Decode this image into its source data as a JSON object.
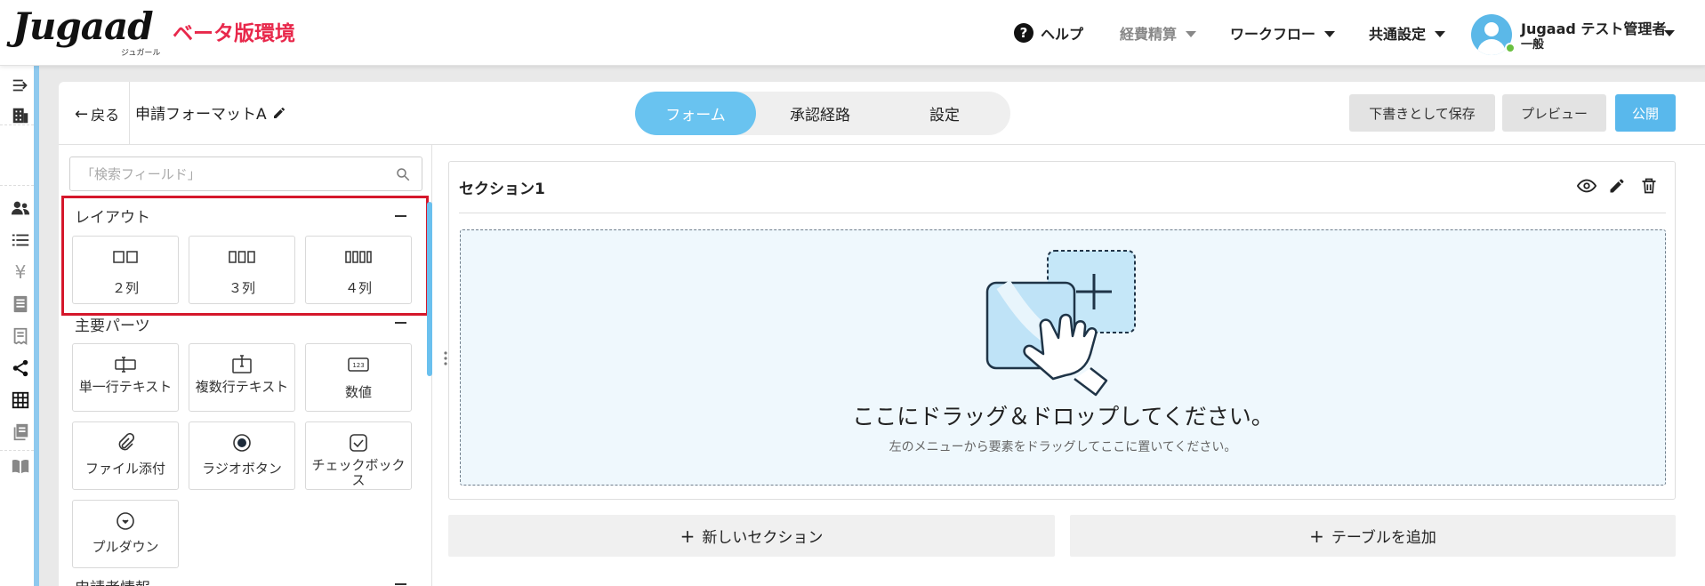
{
  "header": {
    "logo_text": "Jugaad",
    "logo_subtext": "ジュガール",
    "env_label": "ベータ版環境",
    "help_label": "ヘルプ",
    "nav": [
      {
        "label": "経費精算",
        "muted": true
      },
      {
        "label": "ワークフロー",
        "muted": false
      },
      {
        "label": "共通設定",
        "muted": false
      }
    ],
    "user": {
      "name": "Jugaad テスト管理者",
      "role": "一般"
    }
  },
  "sidebar": {
    "icons": [
      "collapse-icon",
      "building-icon",
      "users-icon",
      "list-icon",
      "yen-icon",
      "document-icon",
      "receipt-icon",
      "share-icon",
      "grid-icon",
      "files-icon",
      "book-icon"
    ]
  },
  "editor": {
    "back_label": "戻る",
    "form_title": "申請フォーマットA",
    "tabs": [
      {
        "label": "フォーム",
        "active": true
      },
      {
        "label": "承認経路",
        "active": false
      },
      {
        "label": "設定",
        "active": false
      }
    ],
    "actions": {
      "save_draft": "下書きとして保存",
      "preview": "プレビュー",
      "publish": "公開"
    }
  },
  "palette": {
    "search_placeholder": "「検索フィールド」",
    "groups": [
      {
        "title": "レイアウト",
        "items": [
          {
            "label": "２列",
            "icon": "two-column-icon"
          },
          {
            "label": "３列",
            "icon": "three-column-icon"
          },
          {
            "label": "４列",
            "icon": "four-column-icon"
          }
        ]
      },
      {
        "title": "主要パーツ",
        "items": [
          {
            "label": "単一行テキスト",
            "icon": "single-line-text-icon"
          },
          {
            "label": "複数行テキスト",
            "icon": "multi-line-text-icon"
          },
          {
            "label": "数値",
            "icon": "number-icon"
          },
          {
            "label": "ファイル添付",
            "icon": "attachment-icon"
          },
          {
            "label": "ラジオボタン",
            "icon": "radio-icon"
          },
          {
            "label": "チェックボックス",
            "icon": "checkbox-icon"
          },
          {
            "label": "プルダウン",
            "icon": "dropdown-icon"
          }
        ]
      },
      {
        "title": "申請者情報",
        "items": []
      }
    ]
  },
  "canvas": {
    "section_title": "セクション1",
    "drop_main": "ここにドラッグ＆ドロップしてください。",
    "drop_sub": "左のメニューから要素をドラッグしてここに置いてください。",
    "add_section": "新しいセクション",
    "add_table": "テーブルを追加"
  },
  "colors": {
    "accent": "#59b8ec",
    "brand_red": "#e8284b",
    "highlight": "#d5172b"
  }
}
